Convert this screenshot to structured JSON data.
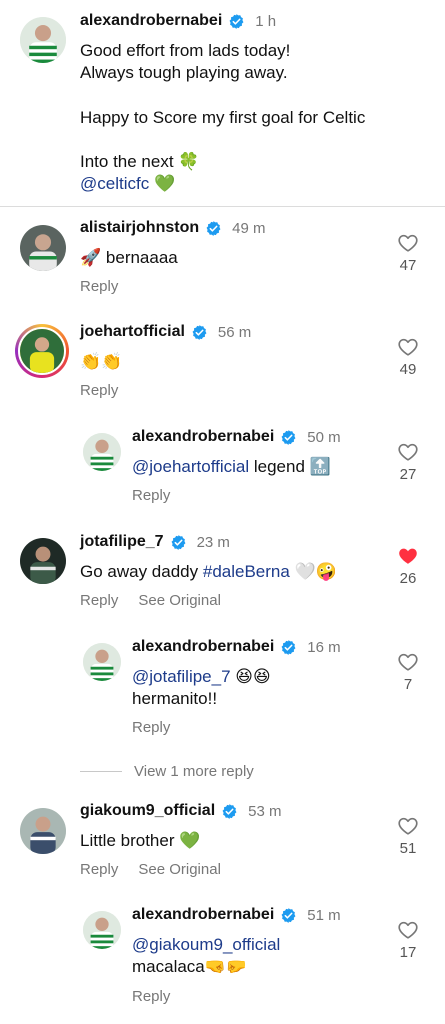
{
  "caption": {
    "username": "alexandrobernabei",
    "time": "1 h",
    "line1": "Good effort from lads today!",
    "line2": "Always tough playing away.",
    "line3": "Happy to Score my first goal for Celtic",
    "line4": "Into the next",
    "line4_emoji": "🍀",
    "line5_mention": "@celticfc",
    "line5_emoji": "💚"
  },
  "comments": [
    {
      "username": "alistairjohnston",
      "time": "49 m",
      "emoji": "🚀",
      "text": "bernaaaa",
      "reply": "Reply",
      "likes": "47"
    },
    {
      "username": "joehartofficial",
      "time": "56 m",
      "emoji": "👏👏",
      "reply": "Reply",
      "likes": "49",
      "replies": [
        {
          "username": "alexandrobernabei",
          "time": "50 m",
          "mention": "@joehartofficial",
          "text": "legend",
          "emoji": "🔝",
          "reply": "Reply",
          "likes": "27"
        }
      ]
    },
    {
      "username": "jotafilipe_7",
      "time": "23 m",
      "text": "Go away daddy",
      "hashtag": "#daleBerna",
      "emoji": "🤍🤪",
      "reply": "Reply",
      "see_original": "See Original",
      "likes": "26",
      "liked": true,
      "replies": [
        {
          "username": "alexandrobernabei",
          "time": "16 m",
          "mention": "@jotafilipe_7",
          "emoji": "😆😆",
          "text2": "hermanito!!",
          "reply": "Reply",
          "likes": "7"
        }
      ],
      "view_more": "View 1 more reply"
    },
    {
      "username": "giakoum9_official",
      "time": "53 m",
      "text": "Little brother",
      "emoji": "💚",
      "reply": "Reply",
      "see_original": "See Original",
      "likes": "51",
      "replies": [
        {
          "username": "alexandrobernabei",
          "time": "51 m",
          "mention": "@giakoum9_official",
          "text2": "macalaca",
          "emoji": "🤜🤛",
          "reply": "Reply",
          "likes": "17"
        }
      ]
    }
  ],
  "colors": {
    "verified": "#1d9bf0",
    "liked": "#ff3040",
    "mention": "#1d3b8a",
    "muted": "#777777"
  },
  "icons": {
    "verified": "verified-badge-icon",
    "like": "heart-icon",
    "liked": "heart-filled-icon"
  }
}
